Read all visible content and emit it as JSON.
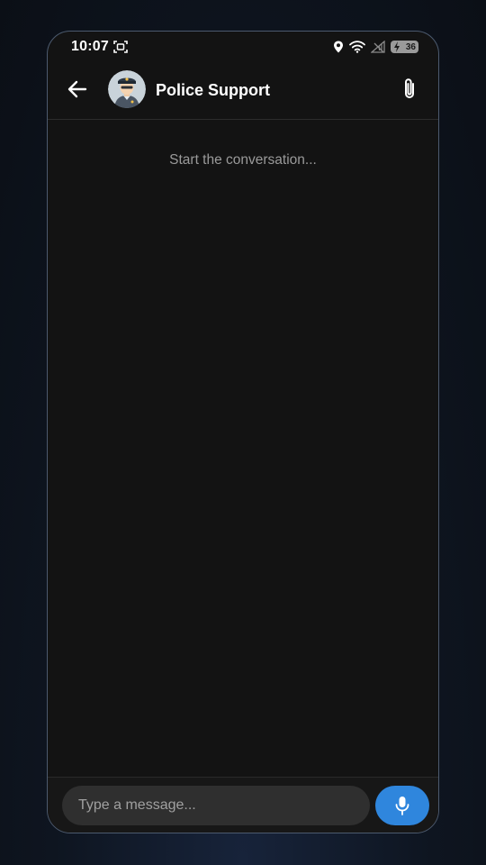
{
  "status_bar": {
    "time": "10:07",
    "battery_level": "36",
    "icons": [
      "screenshot-icon",
      "location-icon",
      "wifi-icon",
      "no-signal-icon",
      "battery-charging-icon"
    ]
  },
  "header": {
    "back_icon": "arrow-left-icon",
    "avatar_icon": "police-officer-avatar",
    "contact_name": "Police Support",
    "attach_icon": "paperclip-icon"
  },
  "chat": {
    "empty_hint": "Start the conversation..."
  },
  "composer": {
    "placeholder": "Type a message...",
    "value": "",
    "mic_icon": "microphone-icon"
  },
  "colors": {
    "background": "#131313",
    "accent": "#2f86dd",
    "input_background": "#2f2f2f",
    "hint_text": "#9a9a9a",
    "frame_border": "#4c5a6e"
  }
}
